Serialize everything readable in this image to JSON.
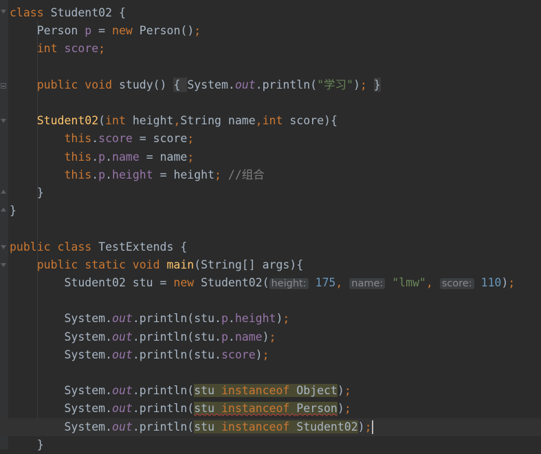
{
  "editor": {
    "lines": [
      {
        "t": [
          [
            "kw",
            "class "
          ],
          [
            "pln",
            "Student02 {"
          ]
        ]
      },
      {
        "t": [
          [
            "pln",
            "    Person "
          ],
          [
            "fld",
            "p"
          ],
          [
            "pln",
            " = "
          ],
          [
            "kw",
            "new "
          ],
          [
            "pln",
            "Person()"
          ],
          [
            "punct",
            ";"
          ]
        ]
      },
      {
        "t": [
          [
            "kw",
            "    int "
          ],
          [
            "fld",
            "score"
          ],
          [
            "punct",
            ";"
          ]
        ]
      },
      {
        "t": [
          [
            "pln",
            ""
          ]
        ]
      },
      {
        "t": [
          [
            "kw",
            "    public void "
          ],
          [
            "dim",
            "study"
          ],
          [
            "pln",
            "() "
          ],
          [
            "fold",
            "{ "
          ],
          [
            "pln",
            "System."
          ],
          [
            "sfld",
            "out"
          ],
          [
            "pln",
            ".println("
          ],
          [
            "str",
            "\"学习\""
          ],
          [
            "pln",
            ")"
          ],
          [
            "punct",
            "; "
          ],
          [
            "fold",
            "}"
          ]
        ]
      },
      {
        "t": [
          [
            "pln",
            ""
          ]
        ]
      },
      {
        "t": [
          [
            "fn",
            "    Student02"
          ],
          [
            "pln",
            "("
          ],
          [
            "kw",
            "int "
          ],
          [
            "pln",
            "height"
          ],
          [
            "punct",
            ","
          ],
          [
            "pln",
            "String name"
          ],
          [
            "punct",
            ","
          ],
          [
            "kw",
            "int "
          ],
          [
            "pln",
            "score){"
          ]
        ]
      },
      {
        "t": [
          [
            "kw",
            "        this"
          ],
          [
            "pln",
            "."
          ],
          [
            "fld",
            "score"
          ],
          [
            "pln",
            " = score"
          ],
          [
            "punct",
            ";"
          ]
        ]
      },
      {
        "t": [
          [
            "kw",
            "        this"
          ],
          [
            "pln",
            "."
          ],
          [
            "fld",
            "p"
          ],
          [
            "pln",
            "."
          ],
          [
            "fld",
            "name"
          ],
          [
            "pln",
            " = name"
          ],
          [
            "punct",
            ";"
          ]
        ]
      },
      {
        "t": [
          [
            "kw",
            "        this"
          ],
          [
            "pln",
            "."
          ],
          [
            "fld",
            "p"
          ],
          [
            "pln",
            "."
          ],
          [
            "fld",
            "height"
          ],
          [
            "pln",
            " = height"
          ],
          [
            "punct",
            "; "
          ],
          [
            "cmt",
            "//组合"
          ]
        ]
      },
      {
        "t": [
          [
            "pln",
            "    }"
          ]
        ]
      },
      {
        "t": [
          [
            "pln",
            "}"
          ]
        ]
      },
      {
        "t": [
          [
            "pln",
            ""
          ]
        ]
      },
      {
        "t": [
          [
            "kw",
            "public class "
          ],
          [
            "pln",
            "TestExtends {"
          ]
        ]
      },
      {
        "t": [
          [
            "kw",
            "    public static void "
          ],
          [
            "fn",
            "main"
          ],
          [
            "pln",
            "(String[] args){"
          ]
        ]
      },
      {
        "t": [
          [
            "pln",
            "        Student02 stu = "
          ],
          [
            "kw",
            "new "
          ],
          [
            "pln",
            "Student02("
          ],
          [
            "hint",
            "height:"
          ],
          [
            "num",
            " 175"
          ],
          [
            "punct",
            ", "
          ],
          [
            "hint",
            "name:"
          ],
          [
            "str",
            " \"lmw\""
          ],
          [
            "punct",
            ", "
          ],
          [
            "hint",
            "score:"
          ],
          [
            "num",
            " 110"
          ],
          [
            "pln",
            ")"
          ],
          [
            "punct",
            ";"
          ]
        ]
      },
      {
        "t": [
          [
            "pln",
            ""
          ]
        ]
      },
      {
        "t": [
          [
            "pln",
            "        System."
          ],
          [
            "sfld",
            "out"
          ],
          [
            "pln",
            ".println(stu."
          ],
          [
            "fld",
            "p"
          ],
          [
            "pln",
            "."
          ],
          [
            "fld",
            "height"
          ],
          [
            "pln",
            ")"
          ],
          [
            "punct",
            ";"
          ]
        ]
      },
      {
        "t": [
          [
            "pln",
            "        System."
          ],
          [
            "sfld",
            "out"
          ],
          [
            "pln",
            ".println(stu."
          ],
          [
            "fld",
            "p"
          ],
          [
            "pln",
            "."
          ],
          [
            "fld",
            "name"
          ],
          [
            "pln",
            ")"
          ],
          [
            "punct",
            ";"
          ]
        ]
      },
      {
        "t": [
          [
            "pln",
            "        System."
          ],
          [
            "sfld",
            "out"
          ],
          [
            "pln",
            ".println(stu."
          ],
          [
            "fld",
            "score"
          ],
          [
            "pln",
            ")"
          ],
          [
            "punct",
            ";"
          ]
        ]
      },
      {
        "t": [
          [
            "pln",
            ""
          ]
        ]
      },
      {
        "t": [
          [
            "pln",
            "        System."
          ],
          [
            "sfld",
            "out"
          ],
          [
            "pln",
            ".println("
          ],
          [
            "hlp",
            "stu "
          ],
          [
            "hlk",
            "instanceof "
          ],
          [
            "hlp",
            "Object"
          ],
          [
            "pln",
            ")"
          ],
          [
            "punct",
            ";"
          ]
        ]
      },
      {
        "t": [
          [
            "pln",
            "        System."
          ],
          [
            "sfld",
            "out"
          ],
          [
            "pln",
            ".println("
          ],
          [
            "hlpe",
            "stu "
          ],
          [
            "hlke",
            "instanceof "
          ],
          [
            "hlpe",
            "Person"
          ],
          [
            "pln",
            ")"
          ],
          [
            "punct",
            ";"
          ]
        ]
      },
      {
        "t": [
          [
            "pln",
            "        System."
          ],
          [
            "sfld",
            "out"
          ],
          [
            "pln",
            ".println("
          ],
          [
            "hlp",
            "stu "
          ],
          [
            "hlk",
            "instanceof "
          ],
          [
            "hlp",
            "Student02"
          ],
          [
            "pln",
            ")"
          ],
          [
            "punct",
            ";"
          ],
          [
            "caret",
            ""
          ]
        ]
      },
      {
        "t": [
          [
            "pln",
            "    }"
          ]
        ]
      }
    ],
    "current_line": 23
  }
}
